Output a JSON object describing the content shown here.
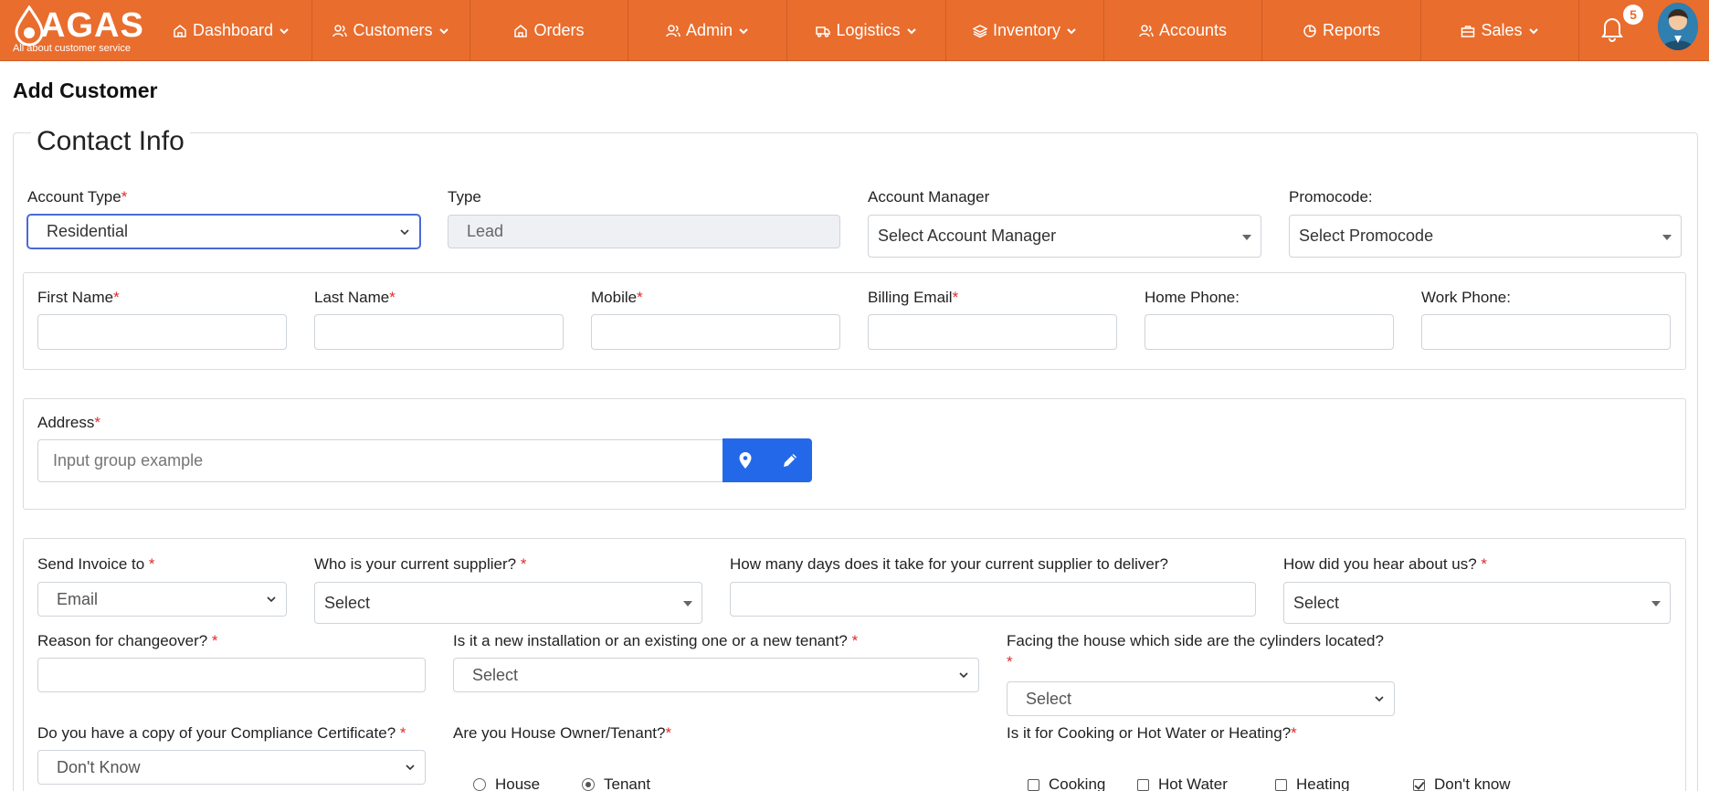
{
  "brand": {
    "name": "AGAS",
    "tagline": "All about customer service"
  },
  "nav": [
    {
      "label": "Dashboard",
      "icon": "home-icon",
      "dropdown": true
    },
    {
      "label": "Customers",
      "icon": "users-icon",
      "dropdown": true
    },
    {
      "label": "Orders",
      "icon": "home-icon",
      "dropdown": false
    },
    {
      "label": "Admin",
      "icon": "users-icon",
      "dropdown": true
    },
    {
      "label": "Logistics",
      "icon": "truck-icon",
      "dropdown": true
    },
    {
      "label": "Inventory",
      "icon": "layers-icon",
      "dropdown": true
    },
    {
      "label": "Accounts",
      "icon": "users-icon",
      "dropdown": false
    },
    {
      "label": "Reports",
      "icon": "pie-chart-icon",
      "dropdown": false
    },
    {
      "label": "Sales",
      "icon": "briefcase-icon",
      "dropdown": true
    }
  ],
  "notifications": {
    "count": "5"
  },
  "page": {
    "title": "Add Customer",
    "section": "Contact Info"
  },
  "form": {
    "account_type": {
      "label": "Account Type",
      "value": "Residential"
    },
    "type": {
      "label": "Type",
      "value": "Lead"
    },
    "account_manager": {
      "label": "Account Manager",
      "value": "Select Account Manager"
    },
    "promocode": {
      "label": "Promocode:",
      "value": "Select Promocode"
    },
    "first_name": {
      "label": "First Name",
      "value": ""
    },
    "last_name": {
      "label": "Last Name",
      "value": ""
    },
    "mobile": {
      "label": "Mobile",
      "value": ""
    },
    "billing_email": {
      "label": "Billing Email",
      "value": ""
    },
    "home_phone": {
      "label": "Home Phone:",
      "value": ""
    },
    "work_phone": {
      "label": "Work Phone:",
      "value": ""
    },
    "address": {
      "label": "Address",
      "placeholder": "Input group example"
    },
    "send_invoice": {
      "label": "Send Invoice to ",
      "value": "Email"
    },
    "current_supplier": {
      "label": "Who is your current supplier? ",
      "value": "Select"
    },
    "delivery_days": {
      "label": "How many days does it take for your current supplier to deliver?",
      "value": ""
    },
    "hear_about": {
      "label": "How did you hear about us? ",
      "value": "Select"
    },
    "changeover_reason": {
      "label": "Reason for changeover? ",
      "value": ""
    },
    "installation": {
      "label": "Is it a new installation or an existing one or a new tenant? ",
      "value": "Select"
    },
    "cylinder_side": {
      "label": "Facing the house which side are the cylinders located?",
      "value": "Select"
    },
    "compliance": {
      "label": "Do you have a copy of your Compliance Certificate? ",
      "value": "Don't Know"
    },
    "owner_tenant": {
      "label": "Are you House Owner/Tenant?",
      "options": [
        "House",
        "Tenant"
      ],
      "selected": "Tenant"
    },
    "usage": {
      "label": "Is it for Cooking or Hot Water or Heating?",
      "options": [
        "Cooking",
        "Hot Water",
        "Heating",
        "Don't know"
      ],
      "checked": [
        "Don't know"
      ]
    }
  },
  "colors": {
    "nav_bg": "#e96d2d",
    "primary_button": "#2368e8",
    "required": "#e02b2b"
  }
}
